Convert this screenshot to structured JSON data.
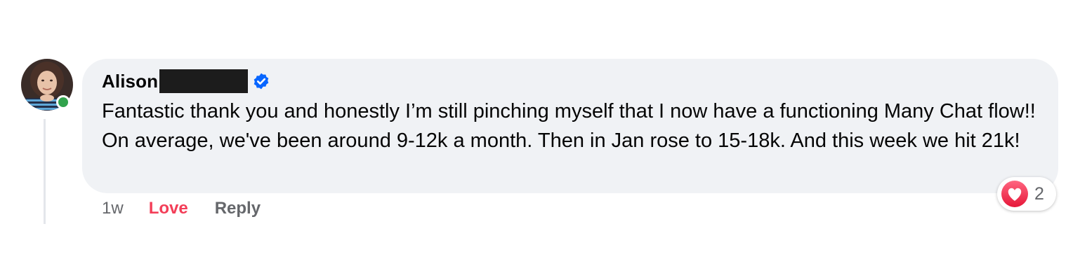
{
  "comment": {
    "author": {
      "name": "Alison",
      "verified": true,
      "online": true
    },
    "text": "Fantastic thank you and honestly I’m still pinching myself that I now have a functioning Many Chat flow!! On average, we've been around 9-12k a month. Then in Jan rose to 15-18k. And this week we hit 21k!",
    "timestamp": "1w",
    "actions": {
      "love_label": "Love",
      "reply_label": "Reply"
    },
    "reactions": {
      "icon": "heart-icon",
      "count": "2"
    }
  },
  "colors": {
    "bubble": "#f0f2f5",
    "love": "#f33e58",
    "verified": "#0866ff",
    "online": "#31a24c",
    "meta": "#65676b"
  }
}
